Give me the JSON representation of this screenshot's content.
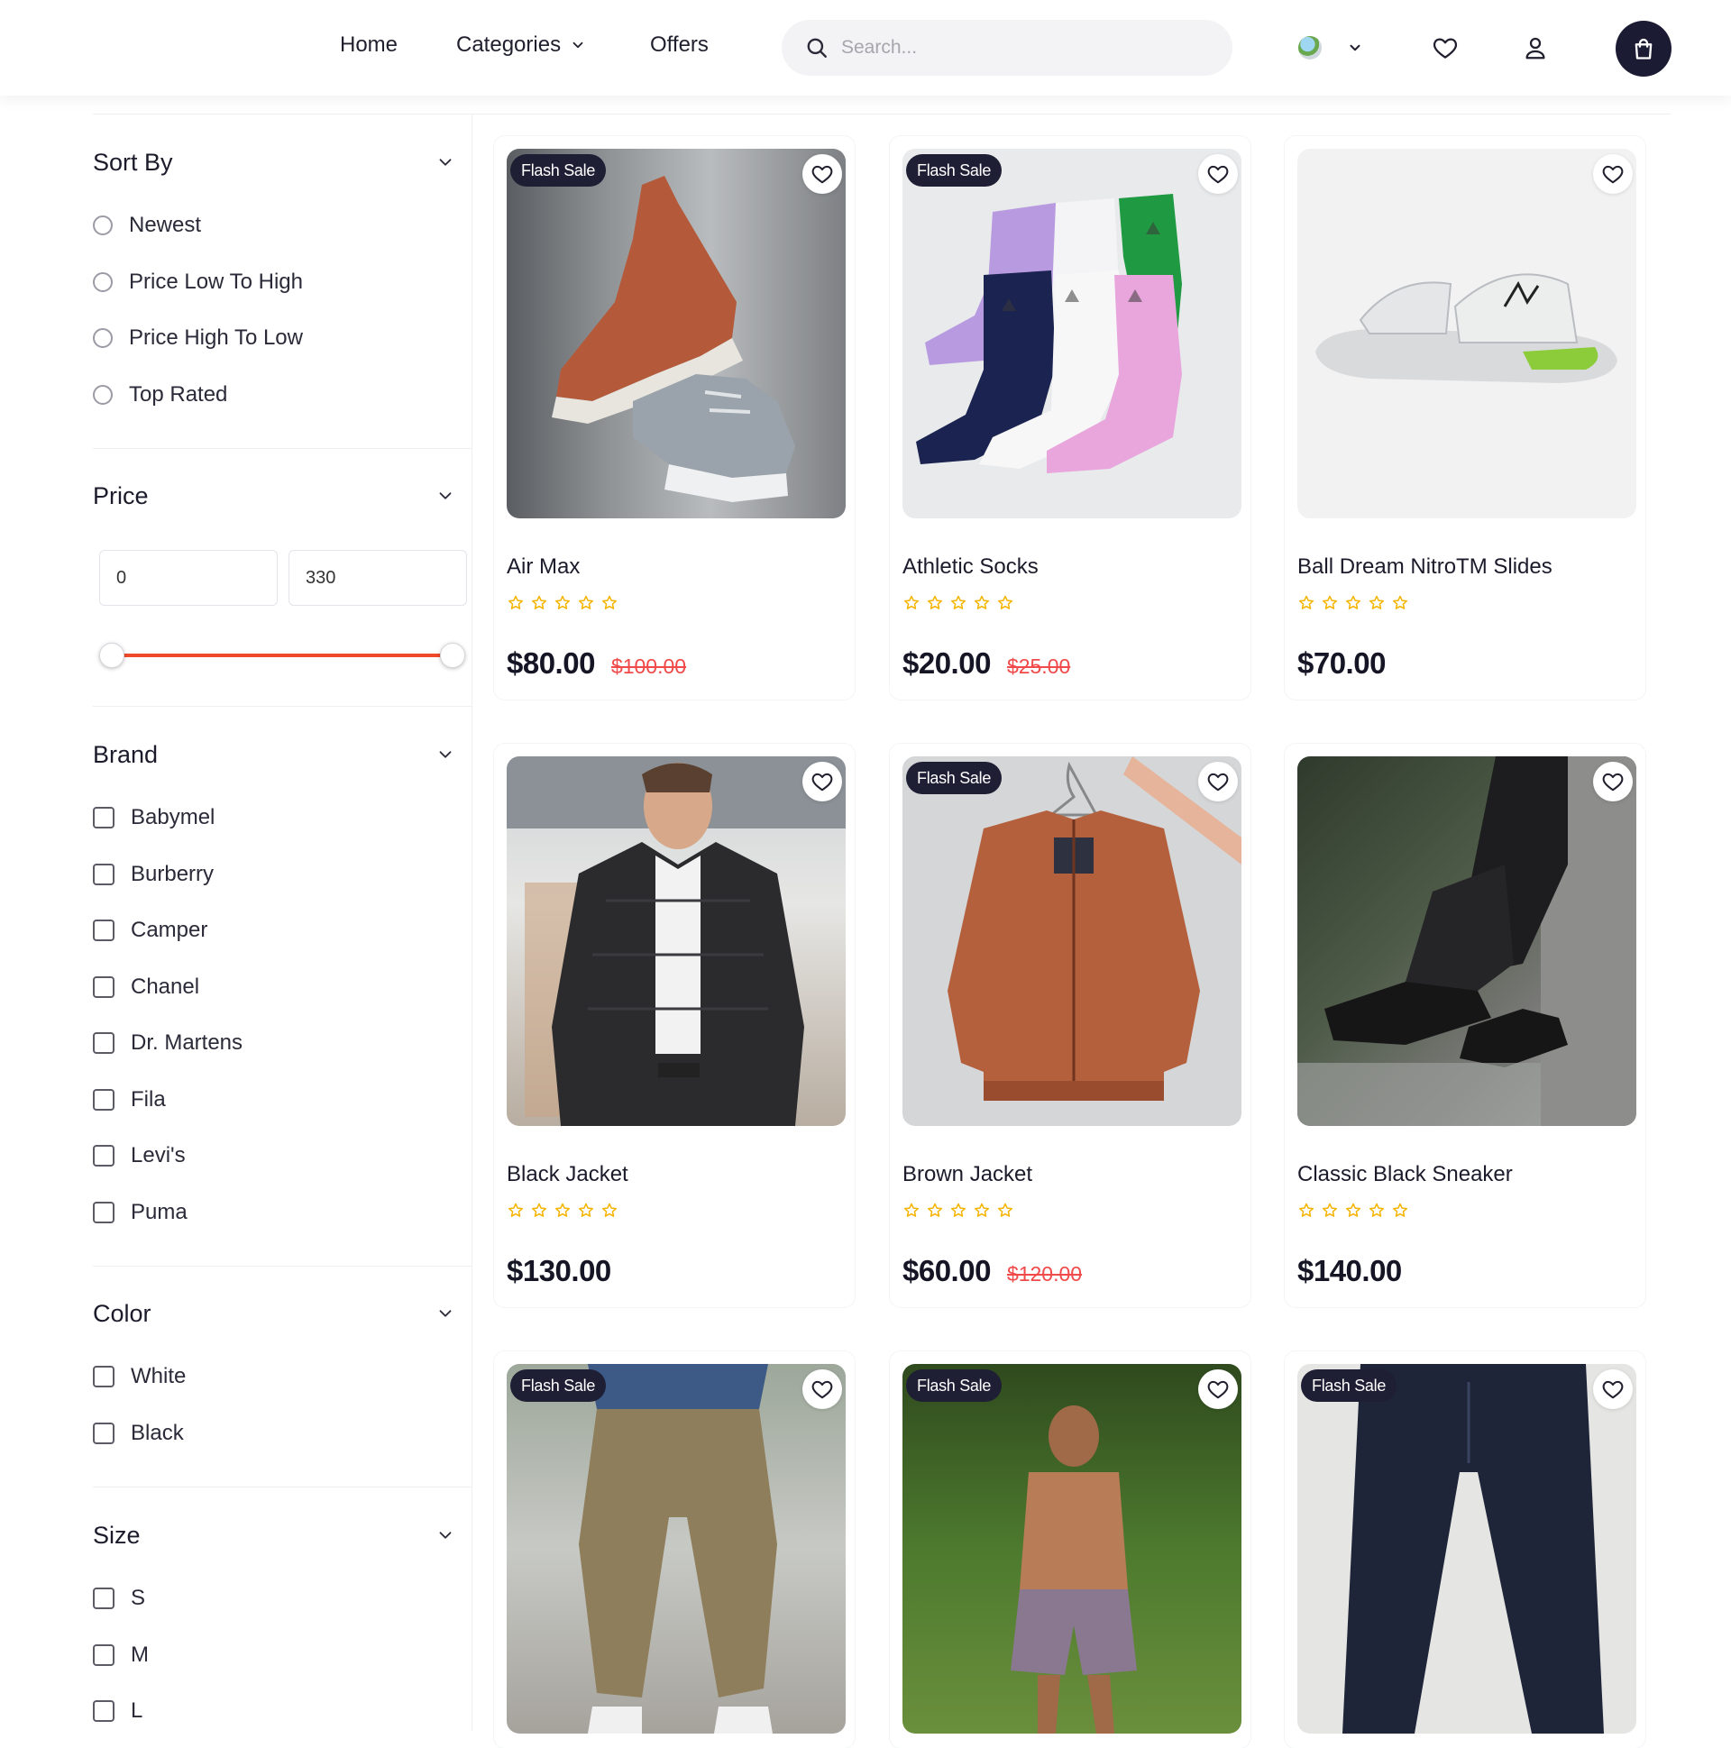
{
  "header": {
    "nav": {
      "home": "Home",
      "categories": "Categories",
      "offers": "Offers"
    },
    "search_placeholder": "Search..."
  },
  "filters": {
    "sort": {
      "title": "Sort By",
      "options": [
        "Newest",
        "Price Low To High",
        "Price High To Low",
        "Top Rated"
      ]
    },
    "price": {
      "title": "Price",
      "min": "0",
      "max": "330"
    },
    "brand": {
      "title": "Brand",
      "options": [
        "Babymel",
        "Burberry",
        "Camper",
        "Chanel",
        "Dr. Martens",
        "Fila",
        "Levi's",
        "Puma"
      ]
    },
    "color": {
      "title": "Color",
      "options": [
        "White",
        "Black"
      ]
    },
    "size": {
      "title": "Size",
      "options": [
        "S",
        "M",
        "L"
      ]
    }
  },
  "products": [
    {
      "name": "Air Max",
      "price": "$80.00",
      "old_price": "$100.00",
      "badge": "Flash Sale"
    },
    {
      "name": "Athletic Socks",
      "price": "$20.00",
      "old_price": "$25.00",
      "badge": "Flash Sale"
    },
    {
      "name": "Ball Dream NitroTM Slides",
      "price": "$70.00"
    },
    {
      "name": "Black Jacket",
      "price": "$130.00"
    },
    {
      "name": "Brown Jacket",
      "price": "$60.00",
      "old_price": "$120.00",
      "badge": "Flash Sale"
    },
    {
      "name": "Classic Black Sneaker",
      "price": "$140.00"
    },
    {
      "badge": "Flash Sale"
    },
    {
      "badge": "Flash Sale"
    },
    {
      "badge": "Flash Sale"
    }
  ],
  "colors": {
    "accent": "#f04a2a",
    "dark": "#1b1b34",
    "sale_price": "#f04a4a",
    "star": "#f5b400"
  }
}
